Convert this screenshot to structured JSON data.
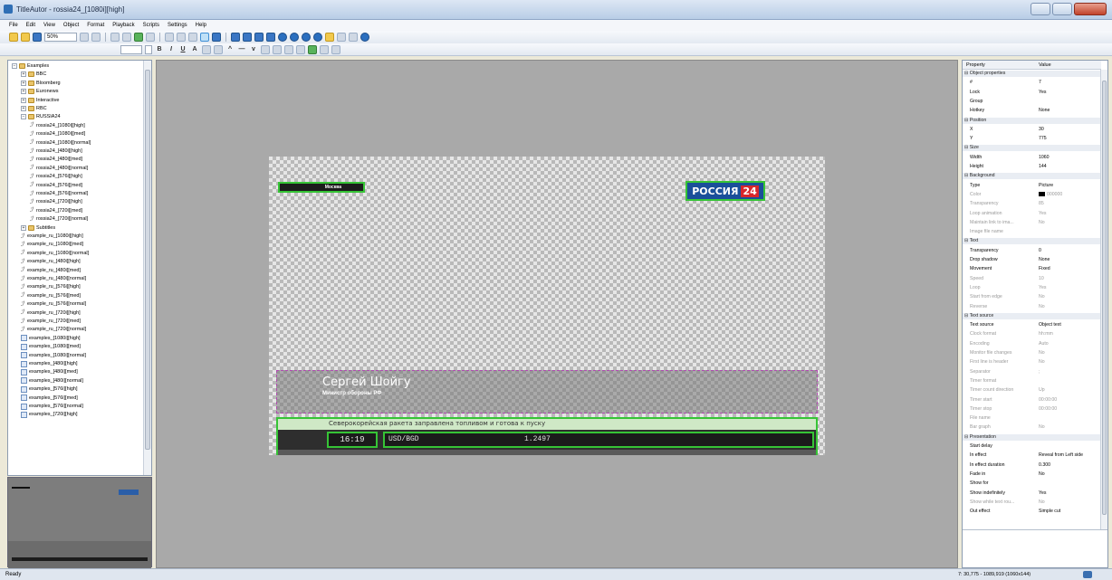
{
  "window": {
    "title": "TitleAutor - rossia24_[1080i][high]"
  },
  "menu": [
    "File",
    "Edit",
    "View",
    "Object",
    "Format",
    "Playback",
    "Scripts",
    "Settings",
    "Help"
  ],
  "toolbar": {
    "zoom": "50%"
  },
  "tree": [
    {
      "label": "Examples",
      "level": 0,
      "kind": "folder",
      "toggle": "−"
    },
    {
      "label": "BBC",
      "level": 1,
      "kind": "folder",
      "toggle": "+"
    },
    {
      "label": "Bloomberg",
      "level": 1,
      "kind": "folder",
      "toggle": "+"
    },
    {
      "label": "Euronews",
      "level": 1,
      "kind": "folder",
      "toggle": "+"
    },
    {
      "label": "Interactive",
      "level": 1,
      "kind": "folder",
      "toggle": "+"
    },
    {
      "label": "RBC",
      "level": 1,
      "kind": "folder",
      "toggle": "+"
    },
    {
      "label": "RUSSIA24",
      "level": 1,
      "kind": "folder",
      "toggle": "−"
    },
    {
      "label": "rossia24_[1080i][high]",
      "level": 2,
      "kind": "file"
    },
    {
      "label": "rossia24_[1080i][med]",
      "level": 2,
      "kind": "file"
    },
    {
      "label": "rossia24_[1080i][normal]",
      "level": 2,
      "kind": "file"
    },
    {
      "label": "rossia24_[480i][high]",
      "level": 2,
      "kind": "file"
    },
    {
      "label": "rossia24_[480i][med]",
      "level": 2,
      "kind": "file"
    },
    {
      "label": "rossia24_[480i][normal]",
      "level": 2,
      "kind": "file"
    },
    {
      "label": "rossia24_[576i][high]",
      "level": 2,
      "kind": "file"
    },
    {
      "label": "rossia24_[576i][med]",
      "level": 2,
      "kind": "file"
    },
    {
      "label": "rossia24_[576i][normal]",
      "level": 2,
      "kind": "file"
    },
    {
      "label": "rossia24_[720i][high]",
      "level": 2,
      "kind": "file"
    },
    {
      "label": "rossia24_[720i][med]",
      "level": 2,
      "kind": "file"
    },
    {
      "label": "rossia24_[720i][normal]",
      "level": 2,
      "kind": "file"
    },
    {
      "label": "Subtitles",
      "level": 1,
      "kind": "folder",
      "toggle": "+"
    },
    {
      "label": "example_ru_[1080i][high]",
      "level": 1,
      "kind": "file"
    },
    {
      "label": "example_ru_[1080i][med]",
      "level": 1,
      "kind": "file"
    },
    {
      "label": "example_ru_[1080i][normal]",
      "level": 1,
      "kind": "file"
    },
    {
      "label": "example_ru_[480i][high]",
      "level": 1,
      "kind": "file"
    },
    {
      "label": "example_ru_[480i][med]",
      "level": 1,
      "kind": "file"
    },
    {
      "label": "example_ru_[480i][normal]",
      "level": 1,
      "kind": "file"
    },
    {
      "label": "example_ru_[576i][high]",
      "level": 1,
      "kind": "file"
    },
    {
      "label": "example_ru_[576i][med]",
      "level": 1,
      "kind": "file"
    },
    {
      "label": "example_ru_[576i][normal]",
      "level": 1,
      "kind": "file"
    },
    {
      "label": "example_ru_[720i][high]",
      "level": 1,
      "kind": "file"
    },
    {
      "label": "example_ru_[720i][med]",
      "level": 1,
      "kind": "file"
    },
    {
      "label": "example_ru_[720i][normal]",
      "level": 1,
      "kind": "file"
    },
    {
      "label": "examples_[1080i][high]",
      "level": 1,
      "kind": "page"
    },
    {
      "label": "examples_[1080i][med]",
      "level": 1,
      "kind": "page"
    },
    {
      "label": "examples_[1080i][normal]",
      "level": 1,
      "kind": "page"
    },
    {
      "label": "examples_[480i][high]",
      "level": 1,
      "kind": "page"
    },
    {
      "label": "examples_[480i][med]",
      "level": 1,
      "kind": "page"
    },
    {
      "label": "examples_[480i][normal]",
      "level": 1,
      "kind": "page"
    },
    {
      "label": "examples_[576i][high]",
      "level": 1,
      "kind": "page"
    },
    {
      "label": "examples_[576i][med]",
      "level": 1,
      "kind": "page"
    },
    {
      "label": "examples_[576i][normal]",
      "level": 1,
      "kind": "page"
    },
    {
      "label": "examples_[720i][high]",
      "level": 1,
      "kind": "page"
    }
  ],
  "stage": {
    "location_label": "Москва",
    "logo_text": "РОССИЯ",
    "logo_num": "24",
    "title_name": "Сергей Шойгу",
    "title_role": "Министр обороны РФ",
    "news": "Северокорейская ракета заправлена топливом и готова к пуску",
    "clock": "16:19",
    "currency": "USD/BGD",
    "rate": "1.2497"
  },
  "properties": {
    "header": {
      "name": "Property",
      "value": "Value"
    },
    "rows": [
      {
        "cat": true,
        "name": "Object properties"
      },
      {
        "name": "#",
        "value": "7"
      },
      {
        "name": "Lock",
        "value": "Yes"
      },
      {
        "name": "Group",
        "value": ""
      },
      {
        "name": "Hotkey",
        "value": "None"
      },
      {
        "cat": true,
        "name": "Position"
      },
      {
        "name": "X",
        "value": "30"
      },
      {
        "name": "Y",
        "value": "775"
      },
      {
        "cat": true,
        "name": "Size"
      },
      {
        "name": "Width",
        "value": "1060"
      },
      {
        "name": "Height",
        "value": "144"
      },
      {
        "cat": true,
        "name": "Background"
      },
      {
        "name": "Type",
        "value": "Picture"
      },
      {
        "name": "Color",
        "value": "000000",
        "swatch": "#000000",
        "dim": true
      },
      {
        "name": "Transparency",
        "value": "85",
        "dim": true
      },
      {
        "name": "Loop animation",
        "value": "Yes",
        "dim": true
      },
      {
        "name": "Maintain link to ima...",
        "value": "No",
        "dim": true
      },
      {
        "name": "Image file name",
        "value": "",
        "dim": true
      },
      {
        "cat": true,
        "name": "Text"
      },
      {
        "name": "Transparency",
        "value": "0"
      },
      {
        "name": "Drop shadow",
        "value": "None"
      },
      {
        "name": "Movement",
        "value": "Fixed"
      },
      {
        "name": "Speed",
        "value": "10",
        "dim": true
      },
      {
        "name": "Loop",
        "value": "Yes",
        "dim": true
      },
      {
        "name": "Start from edge",
        "value": "No",
        "dim": true
      },
      {
        "name": "Reverse",
        "value": "No",
        "dim": true
      },
      {
        "cat": true,
        "name": "Text source"
      },
      {
        "name": "Text source",
        "value": "Object text"
      },
      {
        "name": "Clock format",
        "value": "hh:mm",
        "dim": true
      },
      {
        "name": "Encoding",
        "value": "Auto",
        "dim": true
      },
      {
        "name": "Monitor file changes",
        "value": "No",
        "dim": true
      },
      {
        "name": "First line is header",
        "value": "No",
        "dim": true
      },
      {
        "name": "Separator",
        "value": ";",
        "dim": true
      },
      {
        "name": "Timer format",
        "value": "",
        "dim": true
      },
      {
        "name": "Timer count direction",
        "value": "Up",
        "dim": true
      },
      {
        "name": "Timer start",
        "value": "00:00:00",
        "dim": true
      },
      {
        "name": "Timer stop",
        "value": "00:00:00",
        "dim": true
      },
      {
        "name": "File name",
        "value": "",
        "dim": true
      },
      {
        "name": "Bar graph",
        "value": "No",
        "dim": true
      },
      {
        "cat": true,
        "name": "Presentation"
      },
      {
        "name": "Start delay",
        "value": ""
      },
      {
        "name": "In effect",
        "value": "Reveal from Left side"
      },
      {
        "name": "In effect duration",
        "value": "0.300"
      },
      {
        "name": "Fade in",
        "value": "No"
      },
      {
        "name": "Show for",
        "value": ""
      },
      {
        "name": "Show indefinitely",
        "value": "Yes"
      },
      {
        "name": "Show while text rou...",
        "value": "No",
        "dim": true
      },
      {
        "name": "Out effect",
        "value": "Simple cut"
      }
    ]
  },
  "status": {
    "text": "Ready",
    "coords": "7: 30,775 - 1089,919 (1060x144)"
  }
}
